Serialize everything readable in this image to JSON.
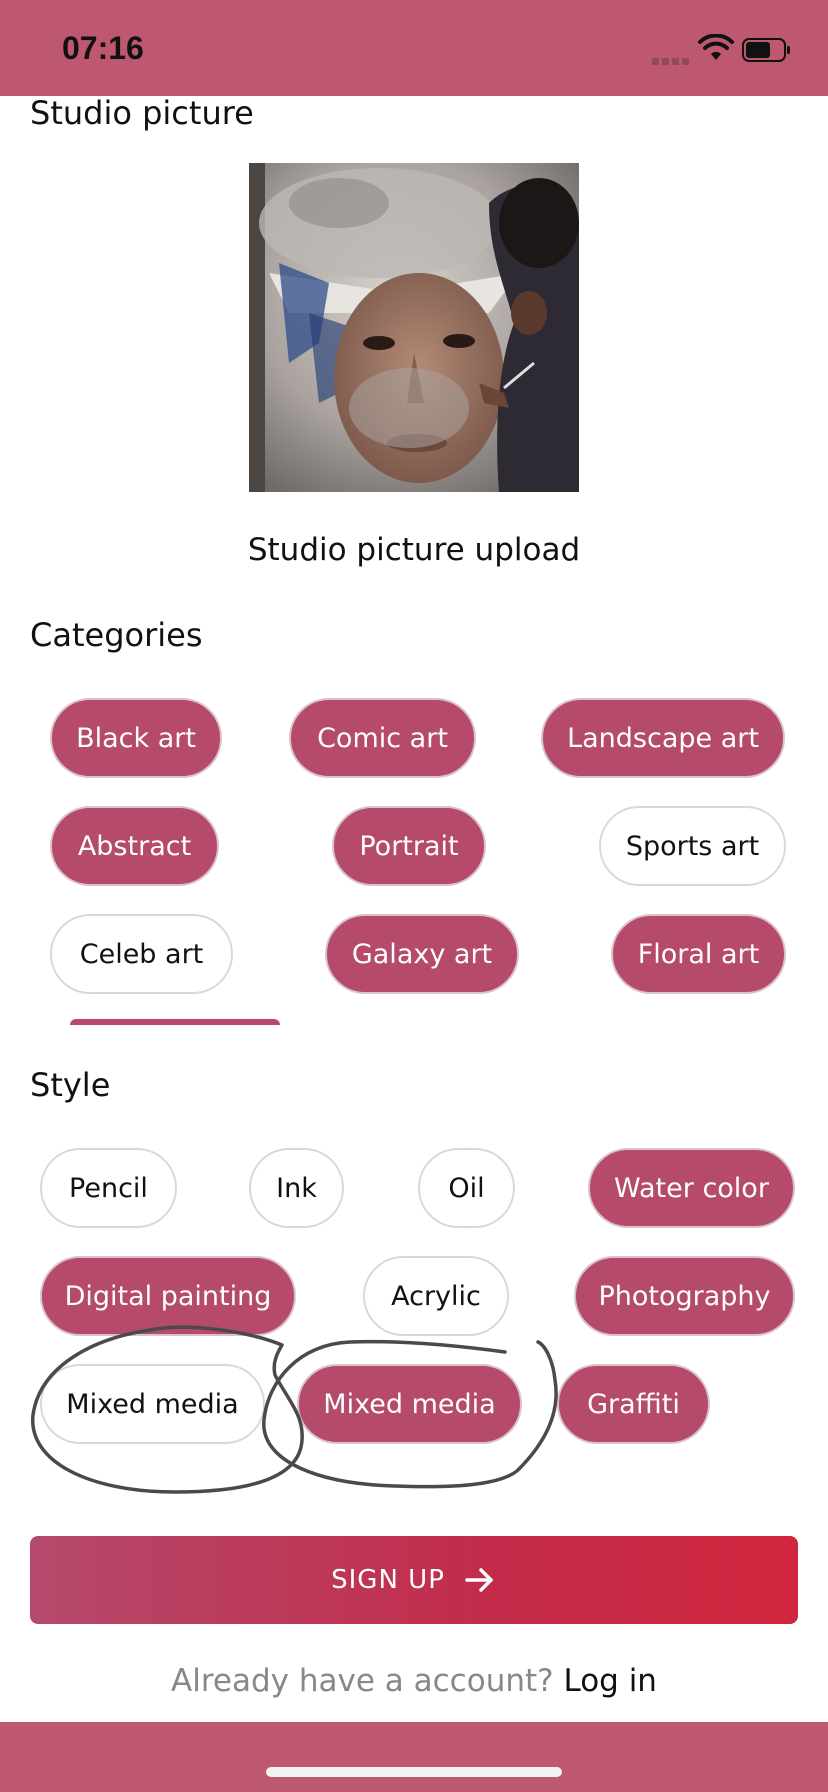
{
  "status_bar": {
    "time": "07:16"
  },
  "studio": {
    "title": "Studio picture",
    "upload_label": "Studio picture upload"
  },
  "categories": {
    "title": "Categories",
    "chips": [
      {
        "label": "Black art",
        "selected": true
      },
      {
        "label": "Comic art",
        "selected": true
      },
      {
        "label": "Landscape art",
        "selected": true
      },
      {
        "label": "Abstract",
        "selected": true
      },
      {
        "label": "Portrait",
        "selected": true
      },
      {
        "label": "Sports art",
        "selected": false
      },
      {
        "label": "Celeb art",
        "selected": false
      },
      {
        "label": "Galaxy art",
        "selected": true
      },
      {
        "label": "Floral art",
        "selected": true
      }
    ]
  },
  "style": {
    "title": "Style",
    "chips": [
      {
        "label": "Pencil",
        "selected": false
      },
      {
        "label": "Ink",
        "selected": false
      },
      {
        "label": "Oil",
        "selected": false
      },
      {
        "label": "Water color",
        "selected": true
      },
      {
        "label": "Digital painting",
        "selected": true
      },
      {
        "label": "Acrylic",
        "selected": false
      },
      {
        "label": "Photography",
        "selected": true
      },
      {
        "label": "Mixed media",
        "selected": false
      },
      {
        "label": "Mixed media",
        "selected": true
      },
      {
        "label": "Graffiti",
        "selected": true
      }
    ]
  },
  "signup_button": {
    "label": "SIGN UP"
  },
  "login_prompt": {
    "question": "Already have a account?",
    "link": "Log in"
  },
  "colors": {
    "accent": "#b54a6b",
    "bar": "#bd5870",
    "button_gradient_end": "#d1253d"
  }
}
